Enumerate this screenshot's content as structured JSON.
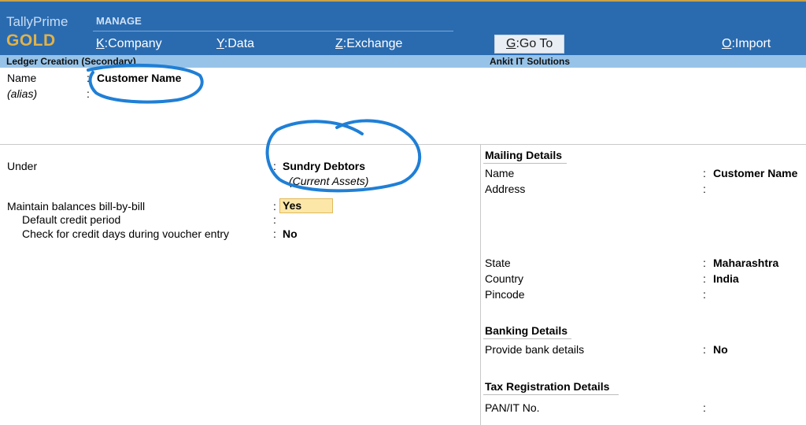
{
  "app": {
    "name": "TallyPrime",
    "edition": "GOLD"
  },
  "menu": {
    "section_label": "MANAGE",
    "items": [
      {
        "key": "K",
        "label": "Company"
      },
      {
        "key": "Y",
        "label": "Data"
      },
      {
        "key": "Z",
        "label": "Exchange"
      },
      {
        "key": "G",
        "label": "Go To"
      },
      {
        "key": "O",
        "label": "Import"
      }
    ]
  },
  "screen": {
    "title": "Ledger Creation (Secondary)",
    "company": "Ankit IT Solutions"
  },
  "form": {
    "name_label": "Name",
    "name_value": "Customer Name",
    "alias_label": "(alias)",
    "under_label": "Under",
    "under_value": "Sundry Debtors",
    "under_parent": "(Current Assets)",
    "bill_by_bill_label": "Maintain balances bill-by-bill",
    "bill_by_bill_value": "Yes",
    "credit_period_label": "Default credit period",
    "credit_days_label": "Check for credit days during voucher entry",
    "credit_days_value": "No",
    "colon": ":"
  },
  "mailing": {
    "heading": "Mailing Details",
    "name_label": "Name",
    "name_value": "Customer Name",
    "address_label": "Address",
    "state_label": "State",
    "state_value": "Maharashtra",
    "country_label": "Country",
    "country_value": "India",
    "pincode_label": "Pincode"
  },
  "banking": {
    "heading": "Banking Details",
    "provide_label": "Provide bank details",
    "provide_value": "No"
  },
  "tax": {
    "heading": "Tax Registration Details",
    "pan_label": "PAN/IT No."
  },
  "colors": {
    "topbar": "#2a6bb0",
    "subbar": "#97c3e8",
    "gold": "#e1b24a",
    "highlight": "#fde7a8",
    "annotation": "#1f7fd6"
  }
}
